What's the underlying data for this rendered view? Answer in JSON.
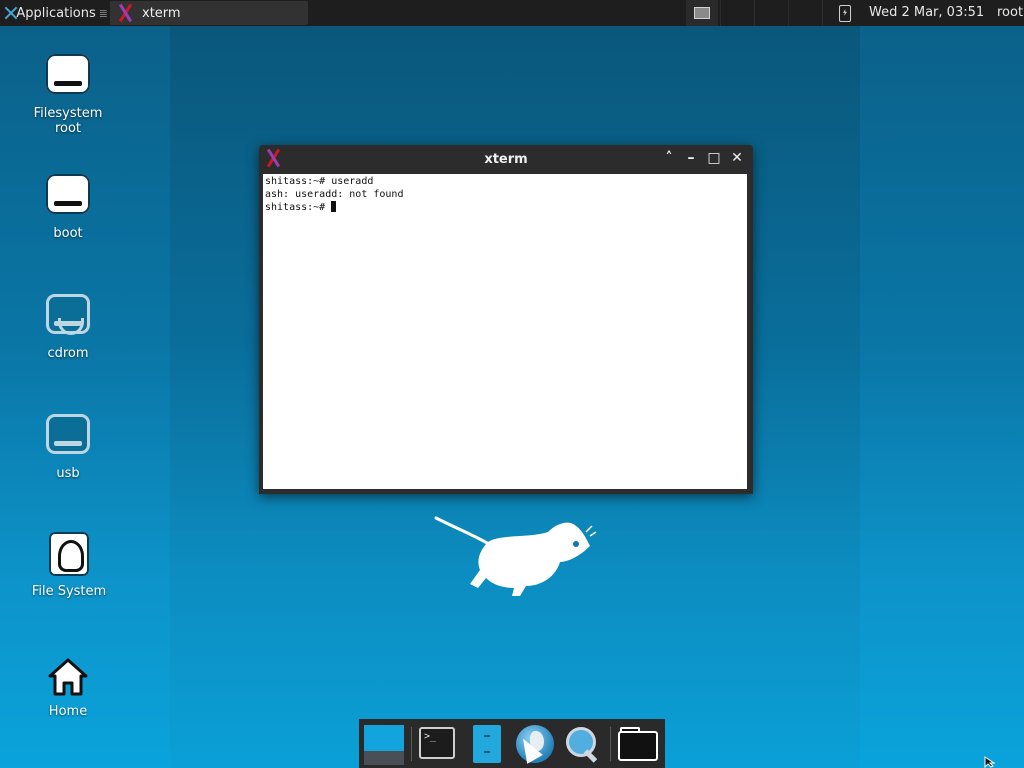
{
  "top_panel": {
    "applications_label": "Applications",
    "applications_sep": "≣",
    "task_title": "xterm",
    "clock": "Wed  2 Mar, 03:51",
    "user": "root"
  },
  "desktop_icons": [
    {
      "label_line1": "Filesystem",
      "label_line2": "root",
      "icon": "drive-icon"
    },
    {
      "label_line1": "boot",
      "icon": "drive-icon"
    },
    {
      "label_line1": "cdrom",
      "icon": "cdrom-icon"
    },
    {
      "label_line1": "usb",
      "icon": "usb-drive-icon"
    },
    {
      "label_line1": "File System",
      "icon": "filesystem-icon"
    },
    {
      "label_line1": "Home",
      "icon": "home-icon"
    }
  ],
  "xterm": {
    "title": "xterm",
    "lines": [
      "shitass:~# useradd",
      "ash: useradd: not found",
      "shitass:~# "
    ],
    "buttons": {
      "shade": "˄",
      "minimize": "–",
      "maximize": "□",
      "close": "✕"
    }
  },
  "dock": {
    "terminal_glyph": ">_"
  },
  "colors": {
    "accent": "#13a3dd",
    "panel": "#1e1e1e",
    "xlogo_red": "#d0162b"
  }
}
